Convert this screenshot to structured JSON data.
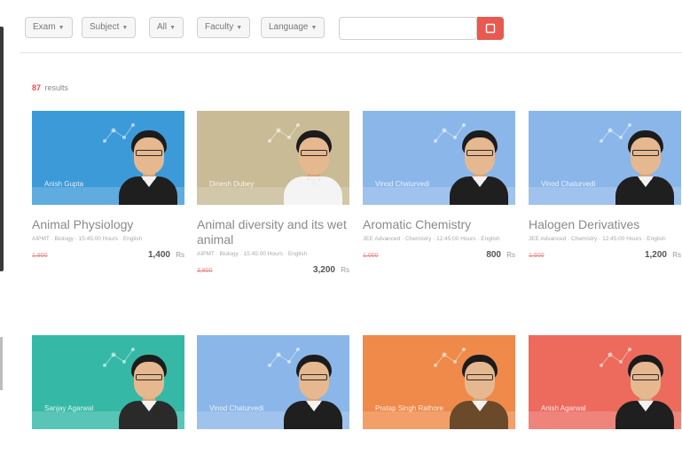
{
  "filters": [
    {
      "label": "Exam"
    },
    {
      "label": "Subject"
    },
    {
      "label": "All"
    },
    {
      "label": "Faculty"
    },
    {
      "label": "Language"
    }
  ],
  "search": {
    "placeholder": "",
    "icon": "search-icon"
  },
  "results": {
    "count": "87",
    "label": "results"
  },
  "cards": [
    {
      "title": "Animal Physiology",
      "teacher": "Anish Gupta",
      "meta": "AIPMT · Biology · 15:45:00 Hours · English",
      "original_price": "1,800",
      "price": "1,400",
      "currency": "Rs",
      "bg": "#3d9ad8",
      "shirt": "#1f1f1f"
    },
    {
      "title": "Animal diversity and its wet animal",
      "teacher": "Dinesh Dubey",
      "meta": "AIPMT · Biology · 15:45:00 Hours · English",
      "original_price": "3,800",
      "price": "3,200",
      "currency": "Rs",
      "bg": "#c9bb96",
      "shirt": "#f4f4f4"
    },
    {
      "title": "Aromatic Chemistry",
      "teacher": "Vinod Chaturvedi",
      "meta": "JEE Advanced · Chemistry · 12:45:00 Hours · English",
      "original_price": "1,000",
      "price": "800",
      "currency": "Rs",
      "bg": "#8bb6ea",
      "shirt": "#1f1f1f"
    },
    {
      "title": "Halogen Derivatives",
      "teacher": "Vinod Chaturvedi",
      "meta": "JEE Advanced · Chemistry · 12:45:00 Hours · English",
      "original_price": "1,500",
      "price": "1,200",
      "currency": "Rs",
      "bg": "#8bb6ea",
      "shirt": "#1f1f1f"
    },
    {
      "title": "",
      "teacher": "Sanjay Agarwal",
      "meta": "",
      "original_price": "",
      "price": "",
      "currency": "",
      "bg": "#35b9a6",
      "shirt": "#2a2a2a"
    },
    {
      "title": "",
      "teacher": "Vinod Chaturvedi",
      "meta": "",
      "original_price": "",
      "price": "",
      "currency": "",
      "bg": "#8bb6ea",
      "shirt": "#1f1f1f"
    },
    {
      "title": "",
      "teacher": "Pratap Singh Rathore",
      "meta": "",
      "original_price": "",
      "price": "",
      "currency": "",
      "bg": "#ef8a4a",
      "shirt": "#6b4a2a"
    },
    {
      "title": "",
      "teacher": "Anish Agarwal",
      "meta": "",
      "original_price": "",
      "price": "",
      "currency": "",
      "bg": "#ec6b5d",
      "shirt": "#1f1f1f"
    }
  ]
}
